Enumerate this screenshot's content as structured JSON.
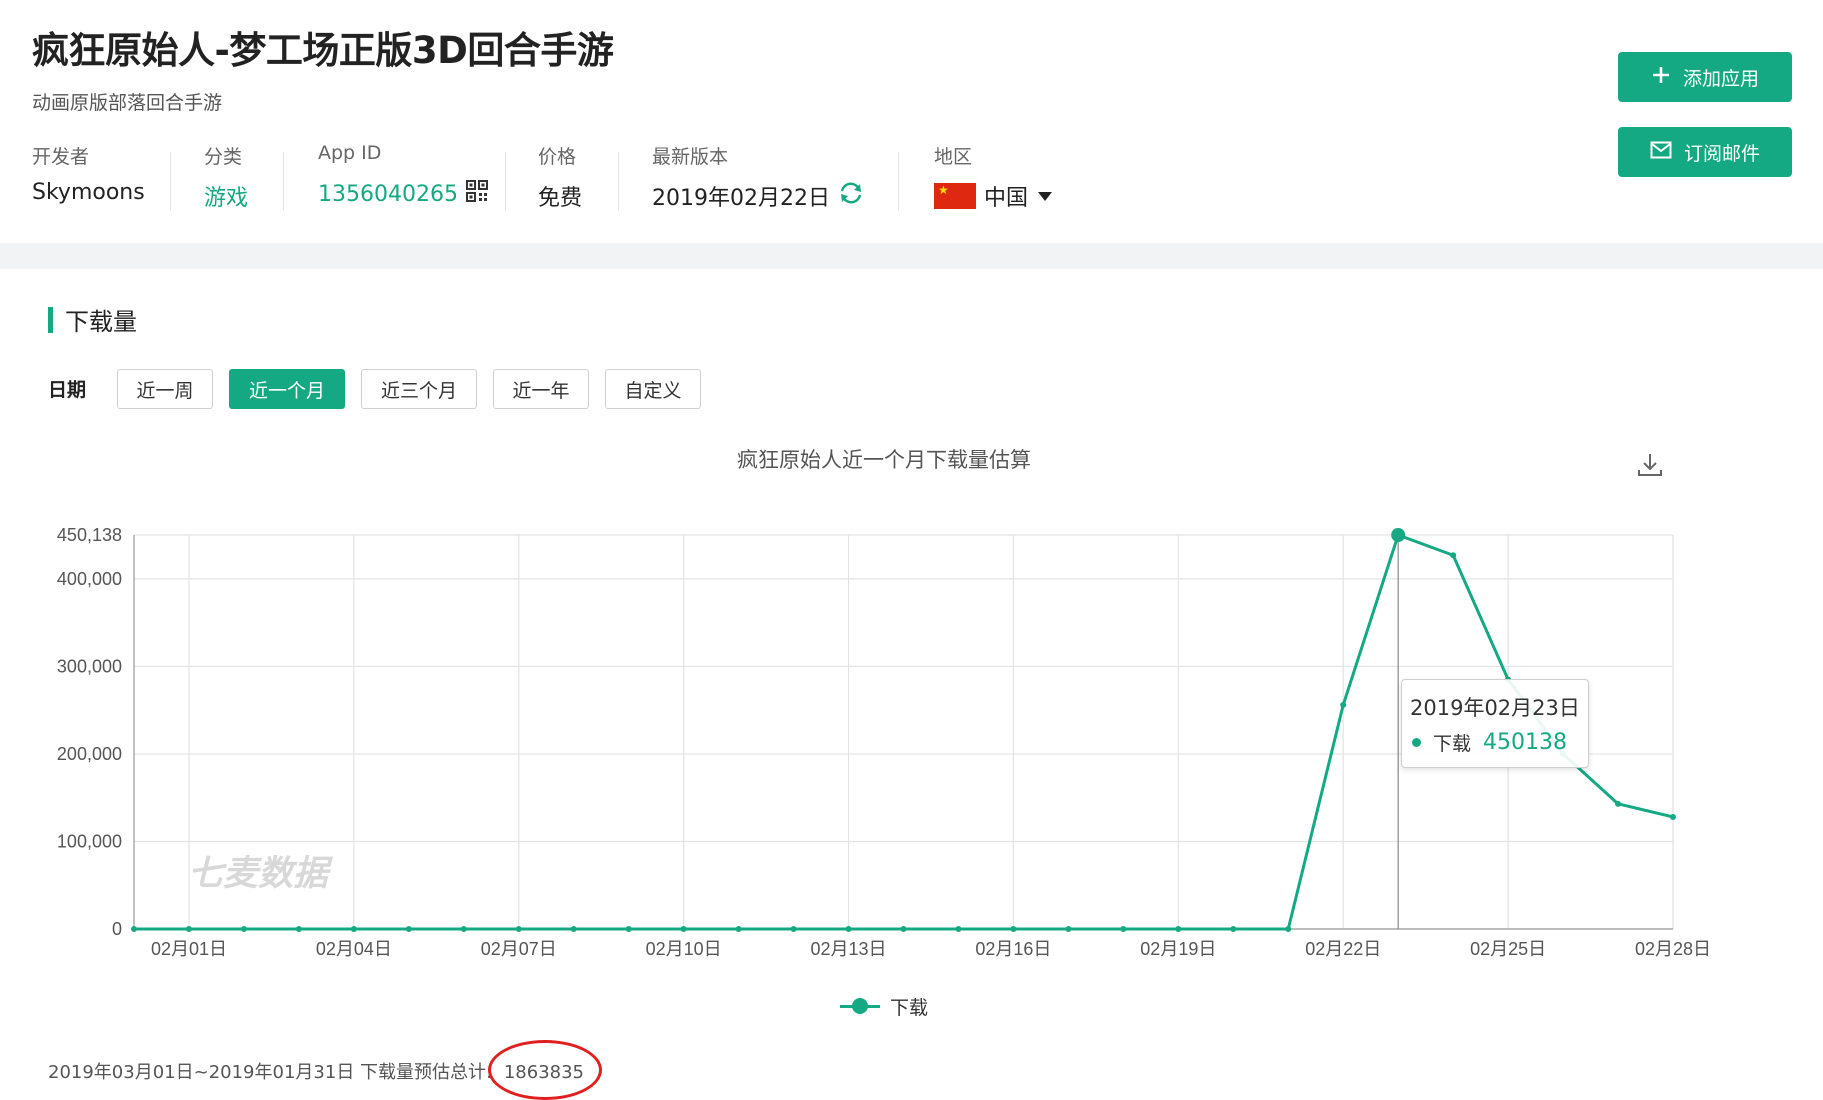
{
  "header": {
    "title": "疯狂原始人-梦工场正版3D回合手游",
    "subtitle": "动画原版部落回合手游",
    "meta": {
      "developer_label": "开发者",
      "developer": "Skymoons",
      "category_label": "分类",
      "category": "游戏",
      "appid_label": "App ID",
      "appid": "1356040265",
      "price_label": "价格",
      "price": "免费",
      "version_label": "最新版本",
      "version_date": "2019年02月22日",
      "region_label": "地区",
      "region": "中国"
    },
    "buttons": {
      "add_app": "添加应用",
      "subscribe_email": "订阅邮件"
    }
  },
  "section": {
    "title": "下载量"
  },
  "date_filter": {
    "label": "日期",
    "options": [
      "近一周",
      "近一个月",
      "近三个月",
      "近一年",
      "自定义"
    ],
    "selected": "近一个月"
  },
  "tooltip": {
    "date": "2019年02月23日",
    "series": "下载",
    "value": "450138"
  },
  "watermark": "七麦数据",
  "legend": {
    "label": "下载"
  },
  "summary": {
    "text": "2019年03月01日~2019年01月31日 下载量预估总计:",
    "total": "1863835"
  },
  "colors": {
    "accent": "#15a983",
    "grid": "#e3e3e3",
    "highlight_circle": "#e02020"
  },
  "icons": [
    "plus-icon",
    "mail-icon",
    "qr-code-icon",
    "refresh-icon",
    "china-flag-icon",
    "caret-down-icon",
    "download-icon"
  ],
  "chart_data": {
    "type": "line",
    "title": "疯狂原始人近一个月下载量估算",
    "x": [
      "01月31日",
      "02月01日",
      "02月02日",
      "02月03日",
      "02月04日",
      "02月05日",
      "02月06日",
      "02月07日",
      "02月08日",
      "02月09日",
      "02月10日",
      "02月11日",
      "02月12日",
      "02月13日",
      "02月14日",
      "02月15日",
      "02月16日",
      "02月17日",
      "02月18日",
      "02月19日",
      "02月20日",
      "02月21日",
      "02月22日",
      "02月23日",
      "02月24日",
      "02月25日",
      "02月26日",
      "02月27日",
      "02月28日"
    ],
    "x_tick_labels": [
      "02月01日",
      "02月04日",
      "02月07日",
      "02月10日",
      "02月13日",
      "02月16日",
      "02月19日",
      "02月22日",
      "02月25日",
      "02月28日"
    ],
    "series": [
      {
        "name": "下载",
        "values": [
          0,
          0,
          0,
          0,
          0,
          0,
          0,
          0,
          0,
          0,
          0,
          0,
          0,
          0,
          0,
          0,
          0,
          0,
          0,
          0,
          0,
          0,
          256000,
          450138,
          427000,
          285000,
          200000,
          143000,
          128000
        ]
      }
    ],
    "y_ticks": [
      0,
      100000,
      200000,
      300000,
      400000,
      450138
    ],
    "y_tick_labels": [
      "0",
      "100,000",
      "200,000",
      "300,000",
      "400,000",
      "450,138"
    ],
    "ylim": [
      0,
      450138
    ],
    "grid": true,
    "legend_position": "bottom-center",
    "highlighted_point": "02月23日"
  }
}
